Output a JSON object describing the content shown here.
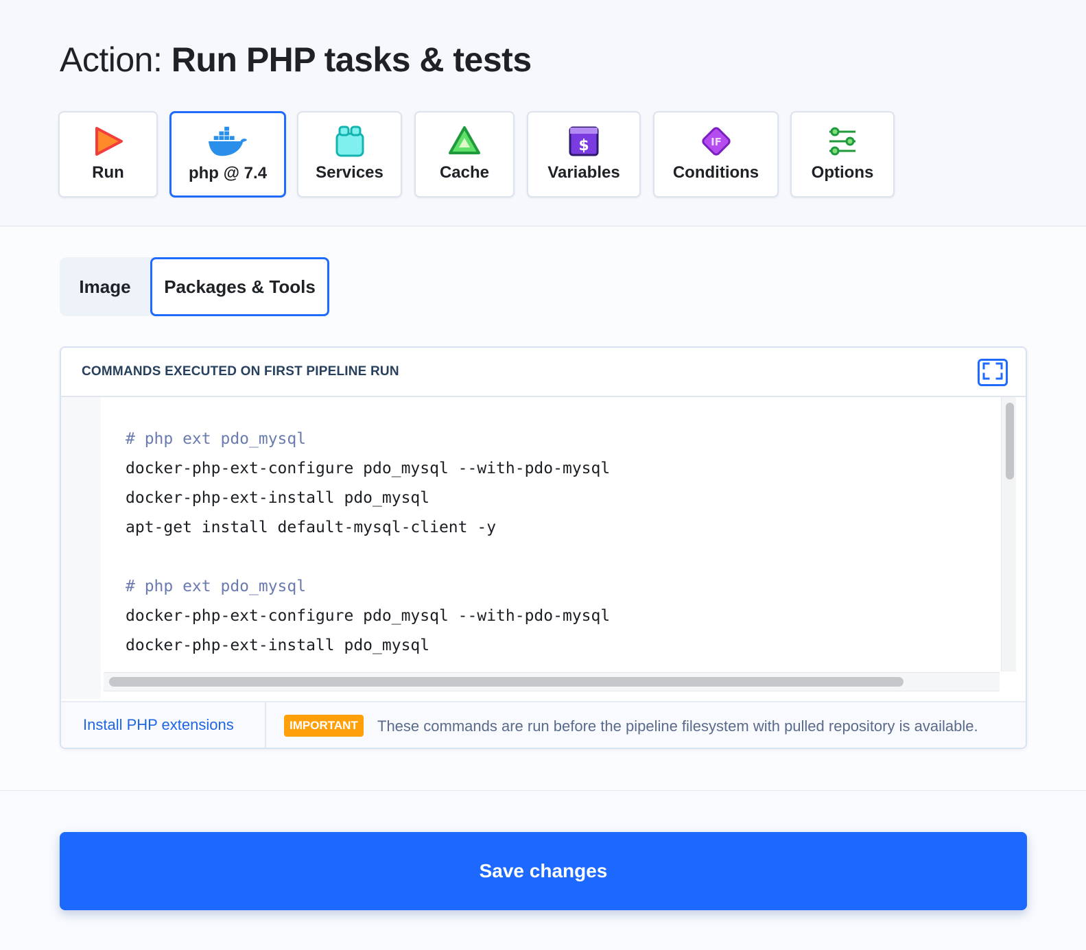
{
  "title": {
    "prefix": "Action: ",
    "name": "Run PHP tasks & tests"
  },
  "action_tabs": [
    {
      "label": "Run",
      "icon": "play-icon",
      "active": false
    },
    {
      "label": "php @ 7.4",
      "icon": "docker-whale-icon",
      "active": true
    },
    {
      "label": "Services",
      "icon": "services-icon",
      "active": false
    },
    {
      "label": "Cache",
      "icon": "cache-icon",
      "active": false
    },
    {
      "label": "Variables",
      "icon": "dollar-variable-icon",
      "active": false
    },
    {
      "label": "Conditions",
      "icon": "if-condition-icon",
      "active": false
    },
    {
      "label": "Options",
      "icon": "sliders-icon",
      "active": false
    }
  ],
  "sub_tabs": [
    {
      "label": "Image",
      "active": false
    },
    {
      "label": "Packages & Tools",
      "active": true
    }
  ],
  "editor": {
    "title": "COMMANDS EXECUTED ON FIRST PIPELINE RUN",
    "lines": [
      {
        "text": "# php ext pdo_mysql",
        "comment": true
      },
      {
        "text": "docker-php-ext-configure pdo_mysql --with-pdo-mysql",
        "comment": false
      },
      {
        "text": "docker-php-ext-install pdo_mysql",
        "comment": false
      },
      {
        "text": "apt-get install default-mysql-client -y",
        "comment": false
      },
      {
        "text": "",
        "comment": false
      },
      {
        "text": "# php ext pdo_mysql",
        "comment": true
      },
      {
        "text": "docker-php-ext-configure pdo_mysql --with-pdo-mysql",
        "comment": false
      },
      {
        "text": "docker-php-ext-install pdo_mysql",
        "comment": false
      }
    ],
    "footer_link": "Install PHP extensions",
    "badge": "IMPORTANT",
    "note": "These commands are run before the pipeline filesystem with pulled repository is available."
  },
  "save_label": "Save changes",
  "colors": {
    "accent": "#1f6bff",
    "badge": "#ff9f0a",
    "comment": "#6a7bb0",
    "link": "#1f66e5"
  }
}
